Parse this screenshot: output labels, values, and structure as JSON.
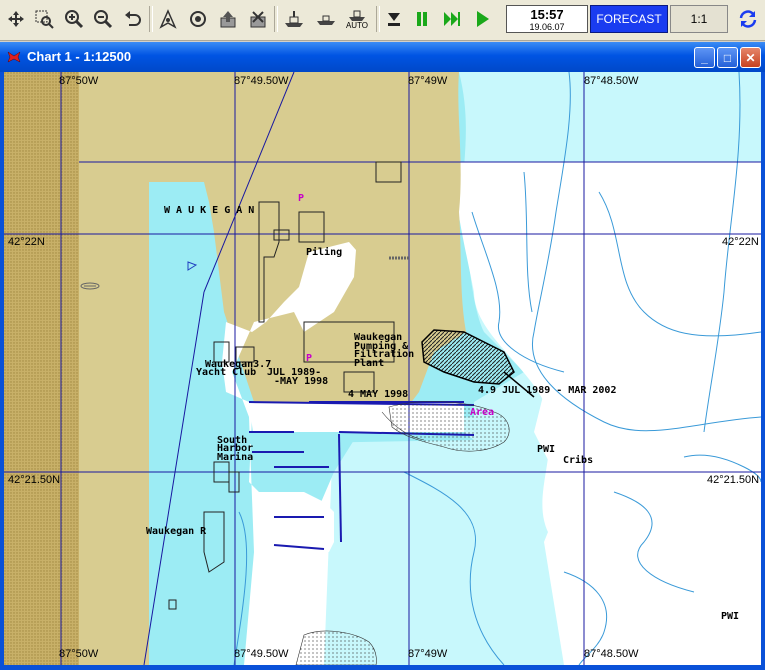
{
  "toolbar": {
    "buttons": [
      "move-tool",
      "zoom-window",
      "zoom-in",
      "zoom-out",
      "undo-view",
      "north-up",
      "center",
      "export",
      "layers",
      "ship-head-up",
      "ship-north-up",
      "auto-mode",
      "stop",
      "pause",
      "fast-forward",
      "play",
      "sync"
    ],
    "auto_label": "AUTO",
    "time": "15:57",
    "date": "19.06.07",
    "forecast_label": "FORECAST",
    "scale_label": "1:1"
  },
  "window": {
    "title": "Chart 1 - 1:12500",
    "minimize": "_",
    "maximize": "□",
    "close": "✕"
  },
  "chart": {
    "top_ticks": [
      "87°50W",
      "87°49.50W",
      "87°49W",
      "87°48.50W"
    ],
    "bottom_ticks": [
      "87°50W",
      "87°49.50W",
      "87°49W",
      "87°48.50W"
    ],
    "left_ticks": [
      "42°22N",
      "42°21.50N"
    ],
    "right_ticks": [
      "42°22N",
      "42°21.50N"
    ],
    "labels": {
      "waukegan": "W A U K E G A N",
      "piling": "Piling",
      "pumping1": "Waukegan",
      "pumping2": "Pumping &",
      "pumping3": "Filtration",
      "pumping4": "Plant",
      "yacht1": "Waukegan3.7",
      "yacht2": "Yacht Club",
      "jul1989": "JUL 1989-",
      "may1998a": "-MAY 1998",
      "may1998b": "4  MAY 1998",
      "depth_note": "4.9  JUL 1989 - MAR 2002",
      "area": "Area",
      "south1": "South",
      "south2": "Harbor",
      "south3": "Marina",
      "pwi1": "PWI",
      "cribs": "Cribs",
      "pwi2": "PWI",
      "waukegan_r": "Waukegan R",
      "p1": "P",
      "p2": "P"
    }
  },
  "colors": {
    "land": "#d8cc90",
    "land_dark": "#c0a858",
    "shallow": "#9cecf4",
    "mid": "#c8f8fc",
    "deep": "#ffffff",
    "grid": "#1818a0",
    "accent": "#1a3cf0"
  }
}
